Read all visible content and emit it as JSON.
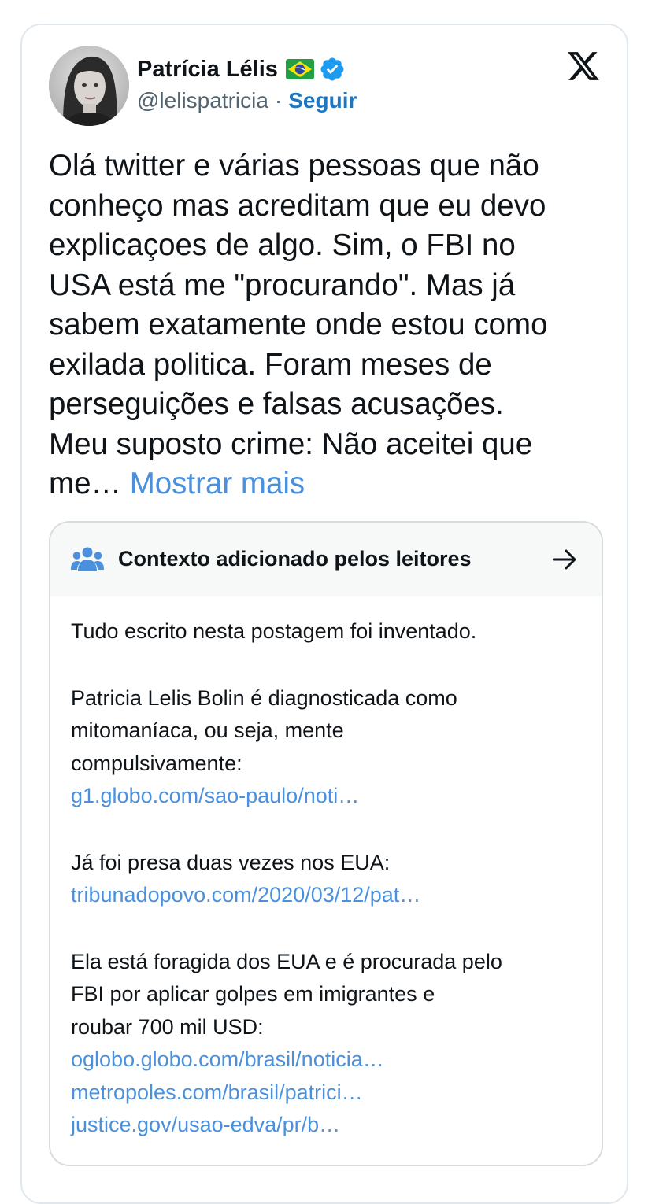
{
  "author": {
    "display_name": "Patrícia Lélis",
    "handle": "@lelispatricia",
    "separator": "·",
    "follow_label": "Seguir"
  },
  "icons": {
    "avatar": "profile-photo",
    "flag": "brazil-flag-icon",
    "verified": "verified-badge-icon",
    "logo": "x-logo-icon",
    "note": "people-icon",
    "arrow": "arrow-right-icon"
  },
  "colors": {
    "link": "#4a90dc",
    "follow": "#1d76c2",
    "verified": "#1d9bf0"
  },
  "tweet": {
    "lines": [
      "Olá twitter e várias pessoas que não",
      "conheço mas acreditam que eu devo",
      "explicaçoes de algo. Sim, o FBI no",
      "USA está me \"procurando\". Mas já",
      "sabem exatamente onde estou como",
      "exilada politica. Foram meses de",
      "perseguições e falsas acusações.",
      "Meu suposto crime: Não aceitei que"
    ],
    "last_line": "me…",
    "show_more": "Mostrar mais"
  },
  "community_note": {
    "title": "Contexto adicionado pelos leitores",
    "paragraph1": "Tudo escrito nesta postagem foi inventado.",
    "paragraph2": {
      "lines": [
        "Patricia Lelis Bolin é diagnosticada como",
        "mitomaníaca, ou seja, mente",
        "compulsivamente:"
      ],
      "link": "g1.globo.com/sao-paulo/noti…"
    },
    "paragraph3": {
      "line": "Já foi presa duas vezes nos EUA:",
      "link": "tribunadopovo.com/2020/03/12/pat…"
    },
    "paragraph4": {
      "lines": [
        "Ela está foragida dos EUA e é procurada pelo",
        "FBI por aplicar golpes em imigrantes e",
        "roubar 700 mil USD:"
      ],
      "links": [
        "oglobo.globo.com/brasil/noticia…",
        "metropoles.com/brasil/patrici…",
        "justice.gov/usao-edva/pr/b…"
      ]
    }
  }
}
